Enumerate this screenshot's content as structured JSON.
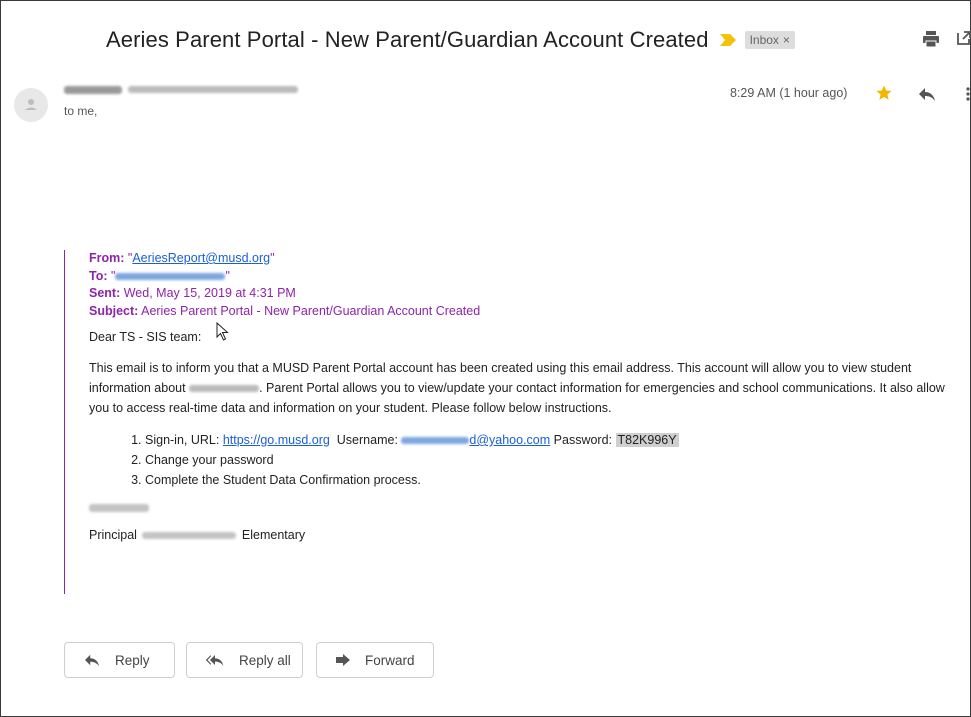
{
  "email": {
    "subject": "Aeries Parent Portal - New Parent/Guardian Account Created",
    "label": "Inbox",
    "label_close": "×",
    "recipient_line": "to me,",
    "time": "8:29 AM (1 hour ago)"
  },
  "quoted": {
    "from_label": "From:",
    "from_value": "AeriesReport@musd.org",
    "to_label": "To:",
    "sent_label": "Sent:",
    "sent_value": "Wed, May 15, 2019 at 4:31 PM",
    "subject_label": "Subject:",
    "subject_value": "Aeries Parent Portal - New Parent/Guardian Account Created"
  },
  "body": {
    "greeting": "Dear TS - SIS team:",
    "para_part1": "This email is to inform you that a MUSD Parent Portal account has been created using this email address. This account will allow you to view student information about",
    "para_part2": ". Parent Portal allows you to view/update your contact information for emergencies and school communications. It also allow you to access real-time data and information on your student. Please follow below instructions.",
    "step1_prefix": "Sign-in, URL: ",
    "step1_url": "https://go.musd.org",
    "step1_username_label": "Username: ",
    "step1_username_suffix": "d@yahoo.com",
    "step1_password_label": " Password: ",
    "step1_password": "T82K996Y",
    "step2": "Change your password",
    "step3": "Complete the Student Data Confirmation process.",
    "principal_prefix": "Principal ",
    "principal_suffix": " Elementary"
  },
  "actions": {
    "reply": "Reply",
    "reply_all": "Reply all",
    "forward": "Forward"
  },
  "colors": {
    "quote_accent": "#8e24aa",
    "link": "#1a5fd6",
    "star": "#f4b400"
  }
}
